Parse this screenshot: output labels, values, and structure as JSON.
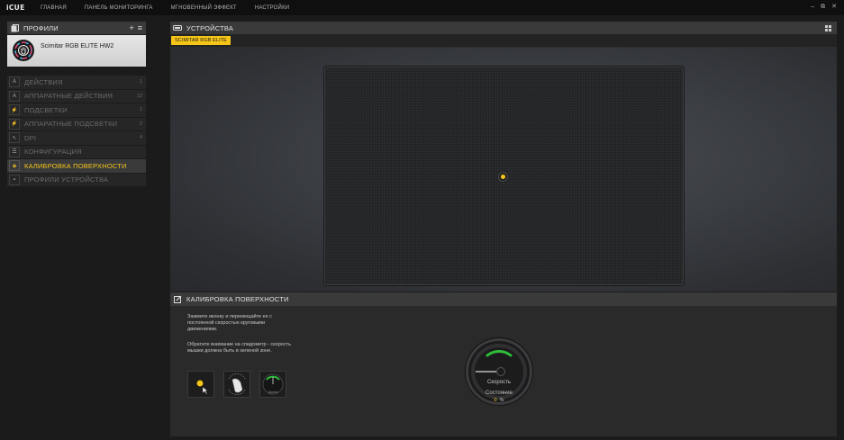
{
  "app": {
    "brand": "iCUE",
    "nav": [
      "ГЛАВНАЯ",
      "ПАНЕЛЬ МОНИТОРИНГА",
      "МГНОВЕННЫЙ ЭФФЕКТ",
      "НАСТРОЙКИ"
    ],
    "window_controls": [
      "–",
      "⧉",
      "✕"
    ]
  },
  "profiles": {
    "title": "ПРОФИЛИ",
    "add": "+",
    "menu": "≡",
    "device_name": "Scimitar RGB ELITE HW2"
  },
  "sidebar": {
    "items": [
      {
        "label": "ДЕЙСТВИЯ",
        "count": "1",
        "icon": "A"
      },
      {
        "label": "АППАРАТНЫЕ ДЕЙСТВИЯ",
        "count": "12",
        "icon": "A"
      },
      {
        "label": "ПОДСВЕТКИ",
        "count": "1",
        "icon": "⚡"
      },
      {
        "label": "АППАРАТНЫЕ ПОДСВЕТКИ",
        "count": "2",
        "icon": "⚡"
      },
      {
        "label": "DPI",
        "count": "4",
        "icon": "↖"
      },
      {
        "label": "КОНФИГУРАЦИЯ",
        "count": "",
        "icon": "☰"
      },
      {
        "label": "КАЛИБРОВКА ПОВЕРХНОСТИ",
        "count": "",
        "icon": "◈"
      },
      {
        "label": "ПРОФИЛИ УСТРОЙСТВА",
        "count": "",
        "icon": "▪"
      }
    ],
    "active_index": 6
  },
  "devices": {
    "title": "УСТРОЙСТВА",
    "tab": "SCIMITAR RGB ELITE"
  },
  "calibration": {
    "title": "КАЛИБРОВКА ПОВЕРХНОСТИ",
    "instruction1": "Зажмите иконку и перемещайте ее с постоянной скоростью круговыми движениями.",
    "instruction2": "Обратите внимание на спидометр - скорость мышки должна быть в зеленой зоне.",
    "gauge_speed_label": "Скорость",
    "gauge_state_label": "Состояние",
    "gauge_state_value": "0",
    "gauge_state_unit": "%",
    "thumb3_label": "Speed"
  },
  "colors": {
    "accent": "#f5c518",
    "gauge_green": "#2fbf3a"
  }
}
